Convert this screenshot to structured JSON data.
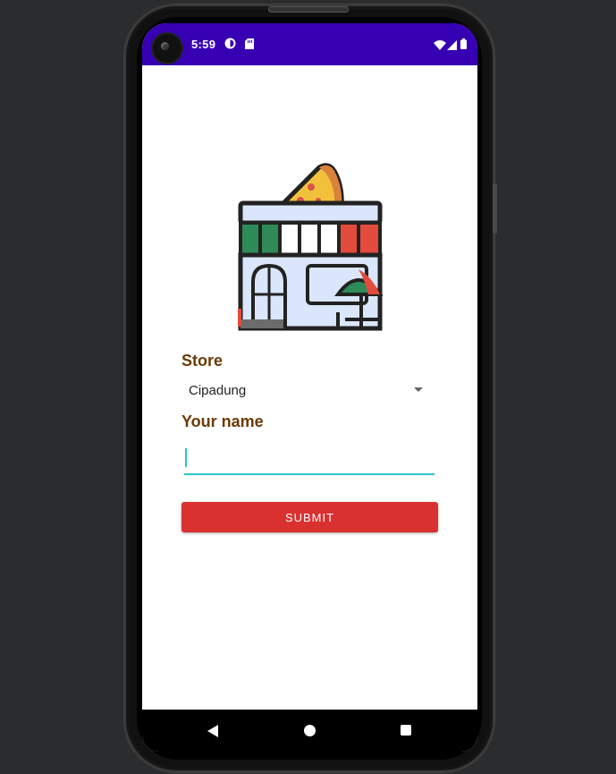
{
  "status_bar": {
    "time": "5:59",
    "icons": [
      "media-icon",
      "sd-card-icon",
      "wifi-icon",
      "signal-icon",
      "battery-icon"
    ]
  },
  "logo": {
    "icon": "pizza-store-icon"
  },
  "form": {
    "store_label": "Store",
    "store_value": "Cipadung",
    "name_label": "Your name",
    "name_value": "",
    "submit_label": "SUBMIT"
  },
  "nav_bar": {
    "icons": [
      "back-icon",
      "home-icon",
      "recents-icon"
    ]
  },
  "colors": {
    "status_bar": "#3700b3",
    "label": "#6b3a06",
    "submit": "#d93030",
    "field_accent": "#26c6c6"
  }
}
